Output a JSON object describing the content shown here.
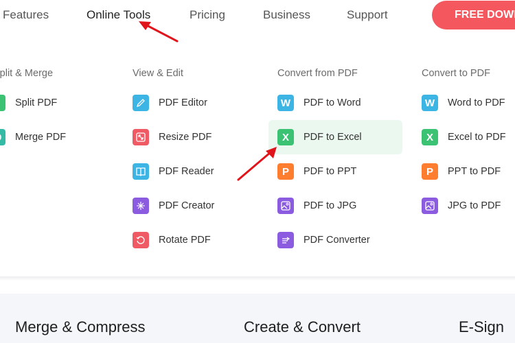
{
  "nav": {
    "items": [
      "Features",
      "Online Tools",
      "Pricing",
      "Business",
      "Support"
    ],
    "active": "Online Tools",
    "cta_label": "FREE DOWNLOAD"
  },
  "colors": {
    "cta": "#f5575e",
    "highlight": "#ebf8ef",
    "green": "#3cc273",
    "teal": "#35bba5",
    "blue": "#3db5e4",
    "red": "#f05a64",
    "purple": "#8c5ce0",
    "orange": "#ff7d2e",
    "annotation_arrow": "#e0141b"
  },
  "menu": {
    "columns": [
      {
        "title": "Split & Merge",
        "items": [
          {
            "label": "Split PDF",
            "icon": "split-icon"
          },
          {
            "label": "Merge PDF",
            "icon": "merge-icon"
          }
        ]
      },
      {
        "title": "View & Edit",
        "items": [
          {
            "label": "PDF Editor",
            "icon": "pencil-icon"
          },
          {
            "label": "Resize PDF",
            "icon": "resize-icon"
          },
          {
            "label": "PDF Reader",
            "icon": "book-icon"
          },
          {
            "label": "PDF Creator",
            "icon": "sparkle-icon"
          },
          {
            "label": "Rotate PDF",
            "icon": "rotate-icon"
          }
        ]
      },
      {
        "title": "Convert from PDF",
        "items": [
          {
            "label": "PDF to Word",
            "icon": "word-icon",
            "glyph": "W"
          },
          {
            "label": "PDF to Excel",
            "icon": "excel-icon",
            "glyph": "X"
          },
          {
            "label": "PDF to PPT",
            "icon": "ppt-icon",
            "glyph": "P"
          },
          {
            "label": "PDF to JPG",
            "icon": "image-icon"
          },
          {
            "label": "PDF Converter",
            "icon": "convert-icon"
          }
        ]
      },
      {
        "title": "Convert to PDF",
        "items": [
          {
            "label": "Word to PDF",
            "icon": "word-icon",
            "glyph": "W"
          },
          {
            "label": "Excel to PDF",
            "icon": "excel-icon",
            "glyph": "X"
          },
          {
            "label": "PPT to PDF",
            "icon": "ppt-icon",
            "glyph": "P"
          },
          {
            "label": "JPG to PDF",
            "icon": "image-icon"
          }
        ]
      }
    ],
    "highlighted_item": "PDF to Excel"
  },
  "bottom_sections": [
    "Merge & Compress",
    "Create & Convert",
    "E-Sign"
  ]
}
